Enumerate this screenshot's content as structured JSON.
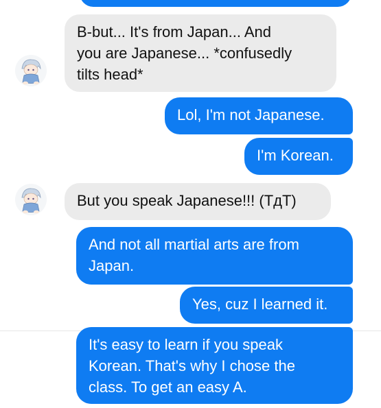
{
  "conversation": {
    "messages": [
      {
        "sender": "other",
        "lines": [
          "B-but... It's from Japan... And",
          "you are Japanese... *confusedly",
          "tilts head*"
        ]
      },
      {
        "sender": "me",
        "text": "Lol, I'm not Japanese."
      },
      {
        "sender": "me",
        "text": "I'm Korean."
      },
      {
        "sender": "other",
        "text": "But you speak Japanese!!! (TдT)"
      },
      {
        "sender": "me",
        "lines": [
          "And not all martial arts are from",
          "Japan."
        ]
      },
      {
        "sender": "me",
        "text": "Yes, cuz I learned it."
      },
      {
        "sender": "me",
        "lines": [
          "It's easy to learn if you speak",
          "Korean. That's why I chose the",
          "class. To get an easy A."
        ]
      }
    ]
  },
  "colors": {
    "outgoing_bubble": "#0f7cf2",
    "incoming_bubble": "#ebebeb",
    "background": "#ffffff"
  },
  "icons": {
    "avatar": "chibi-character-avatar-icon"
  }
}
